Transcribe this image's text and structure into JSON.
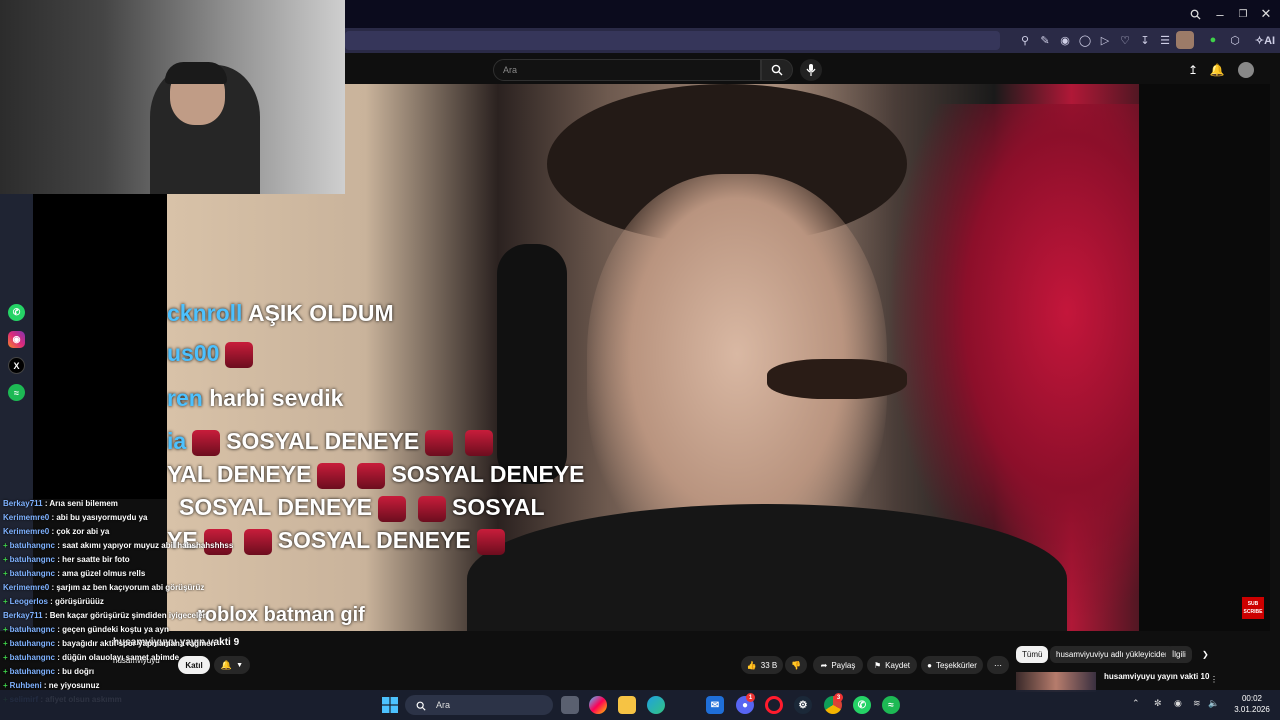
{
  "youtube": {
    "search_placeholder": "Ara",
    "video": {
      "title": "husamviyuyu yayın vakti 9",
      "channel": "husamviyuyu",
      "join_label": "Katıl",
      "likes": "33 B",
      "share_label": "Paylaş",
      "save_label": "Kaydet",
      "thanks_label": "Teşekkürler"
    },
    "chips": [
      "Tümü",
      "husamviyuviyu adlı yükleyiciden",
      "İlgili"
    ],
    "recommended_title": "husamviyuyu yayın vakti 10"
  },
  "video_chat": [
    {
      "name": "cknroll",
      "text": "AŞIK OLDUM"
    },
    {
      "name": "us00",
      "text": ""
    },
    {
      "name": "ren",
      "text": "harbi sevdik"
    },
    {
      "name": "ia",
      "text": "SOSYAL DENEYE"
    },
    {
      "name": "",
      "text": "YAL DENEYE"
    },
    {
      "name": "",
      "text": "SOSYAL DENEYE"
    },
    {
      "name": "",
      "text": "SOSYAL DENEYE"
    },
    {
      "name": "",
      "text": "SOSYAL"
    },
    {
      "name": "",
      "text": "YE"
    },
    {
      "name": "",
      "text": "SOSYAL DENEYE"
    },
    {
      "name": "",
      "text": "roblox batman gif"
    }
  ],
  "overlay_chat": [
    {
      "user": "Berkay711",
      "msg": "Arıa seni bilemem",
      "badge": ""
    },
    {
      "user": "Kerimemre0",
      "msg": "abi bu yasıyormuydu ya",
      "badge": ""
    },
    {
      "user": "Kerimemre0",
      "msg": "çok zor abi ya",
      "badge": ""
    },
    {
      "user": "batuhangnc",
      "msg": "saat akımı yapıyor muyuz abil hahshahshhss",
      "badge": "+"
    },
    {
      "user": "batuhangnc",
      "msg": "her saatte bir foto",
      "badge": "+"
    },
    {
      "user": "batuhangnc",
      "msg": "ama güzel olmus rells",
      "badge": "+"
    },
    {
      "user": "Kerimemre0",
      "msg": "şarjım az ben kaçıyorum abi görüşürüz",
      "badge": ""
    },
    {
      "user": "Leogerlos",
      "msg": "görüşürüüüz",
      "badge": "+"
    },
    {
      "user": "Berkay711",
      "msg": "Ben kaçar görüşürüz şimdiden iyigeceler",
      "badge": ""
    },
    {
      "user": "batuhangnc",
      "msg": "geçen gündeki koştu ya ayn",
      "badge": "+"
    },
    {
      "user": "batuhangnc",
      "msg": "bayağıdır aktif spor yapmamana rağmen",
      "badge": "+"
    },
    {
      "user": "batuhangnc",
      "msg": "düğün olauolayı samet abimde",
      "badge": "+"
    },
    {
      "user": "batuhangnc",
      "msg": "bu doğrı",
      "badge": "+"
    },
    {
      "user": "Ruhbeni",
      "msg": "ne yiyosunuz",
      "badge": "+"
    },
    {
      "user": "selimirf",
      "msg": "afiyet olsun askımm",
      "badge": "+"
    }
  ],
  "taskbar": {
    "search_placeholder": "Ara",
    "time": "00:02",
    "date": "3.01.2026",
    "badges": {
      "discord": "1",
      "chrome": "3"
    }
  },
  "video_overlay_badge": "SUB SCRIBE",
  "colors": {
    "accent": "#c4163b",
    "youtube_bg": "#0f0f0f",
    "chat_user": "#7fb2ff"
  }
}
